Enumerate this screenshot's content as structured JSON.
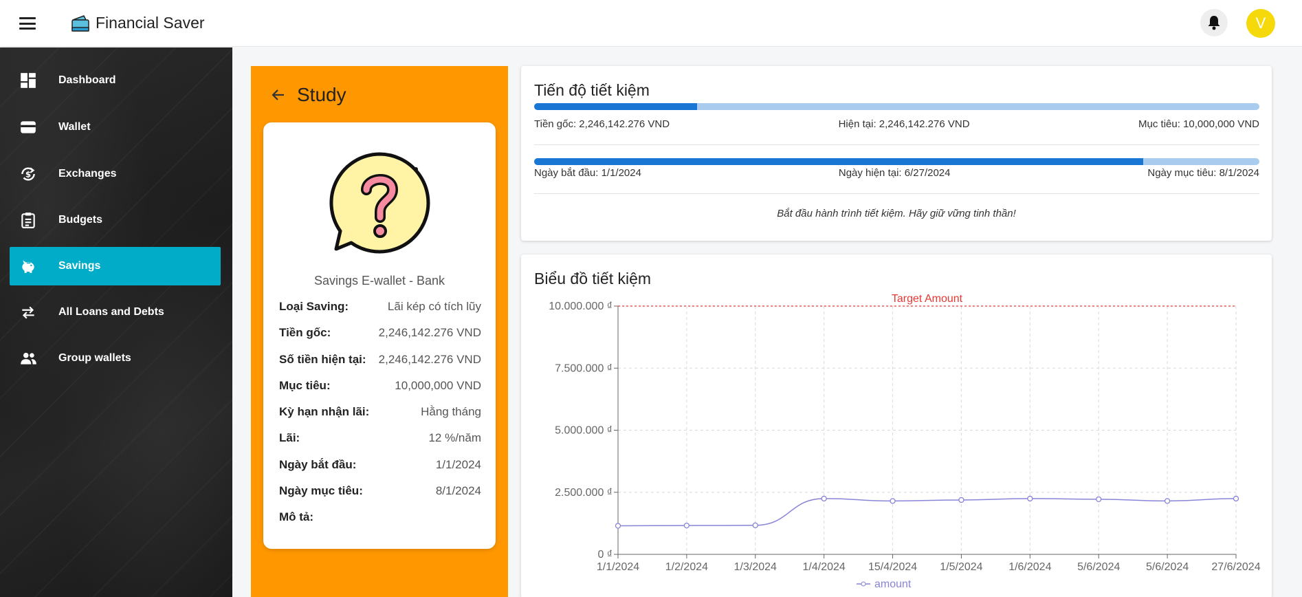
{
  "header": {
    "app_title": "Financial Saver",
    "avatar_letter": "V",
    "menu_icon": "menu-icon",
    "bell_icon": "bell-icon",
    "logo_icon": "wallet-logo-icon"
  },
  "sidebar": {
    "items": [
      {
        "label": "Dashboard",
        "icon": "dashboard-icon",
        "active": false
      },
      {
        "label": "Wallet",
        "icon": "wallet-icon",
        "active": false
      },
      {
        "label": "Exchanges",
        "icon": "exchange-icon",
        "active": false
      },
      {
        "label": "Budgets",
        "icon": "clipboard-icon",
        "active": false
      },
      {
        "label": "Savings",
        "icon": "piggy-bank-icon",
        "active": true
      },
      {
        "label": "All Loans and Debts",
        "icon": "transfer-arrows-icon",
        "active": false
      },
      {
        "label": "Group wallets",
        "icon": "group-icon",
        "active": false
      }
    ],
    "active_color": "#00acc8"
  },
  "saving": {
    "title": "Study",
    "subtitle": "Savings E-wallet - Bank",
    "icon": "question-bubble-icon",
    "details": [
      {
        "label": "Loại Saving:",
        "value": "Lãi kép có tích lũy"
      },
      {
        "label": "Tiền gốc:",
        "value": "2,246,142.276 VND"
      },
      {
        "label": "Số tiền hiện tại:",
        "value": "2,246,142.276 VND"
      },
      {
        "label": "Mục tiêu:",
        "value": "10,000,000 VND"
      },
      {
        "label": "Kỳ hạn nhận lãi:",
        "value": "Hằng tháng"
      },
      {
        "label": "Lãi:",
        "value": "12 %/năm"
      },
      {
        "label": "Ngày bắt đầu:",
        "value": "1/1/2024"
      },
      {
        "label": "Ngày mục tiêu:",
        "value": "8/1/2024"
      },
      {
        "label": "Mô tả:",
        "value": ""
      }
    ],
    "panel_color": "#ff9700"
  },
  "progress": {
    "title": "Tiến độ tiết kiệm",
    "amount_fraction": 0.2246,
    "amount_labels": {
      "principal": "Tiền gốc: 2,246,142.276 VND",
      "current": "Hiện tại: 2,246,142.276 VND",
      "target": "Mục tiêu: 10,000,000 VND"
    },
    "time_fraction": 0.84,
    "time_labels": {
      "start": "Ngày bắt đầu: 1/1/2024",
      "current": "Ngày hiện tại: 6/27/2024",
      "target": "Ngày mục tiêu: 8/1/2024"
    },
    "motto": "Bắt đầu hành trình tiết kiệm. Hãy giữ vững tinh thần!",
    "bar_color": "#1976d2",
    "track_color": "#a9cbee"
  },
  "chart_data": {
    "type": "line",
    "title": "Biểu đồ tiết kiệm",
    "categories": [
      "1/1/2024",
      "1/2/2024",
      "1/3/2024",
      "1/4/2024",
      "15/4/2024",
      "1/5/2024",
      "1/6/2024",
      "5/6/2024",
      "5/6/2024",
      "27/6/2024"
    ],
    "series": [
      {
        "name": "amount",
        "values": [
          1150000,
          1160000,
          1170000,
          2246142,
          2150000,
          2190000,
          2246142,
          2220000,
          2150000,
          2246142
        ],
        "color": "#8884d8"
      }
    ],
    "ylim": [
      0,
      10000000
    ],
    "yticks": [
      0,
      2500000,
      5000000,
      7500000,
      10000000
    ],
    "ytick_labels": [
      "0 ₫",
      "2.500.000 ₫",
      "5.000.000 ₫",
      "7.500.000 ₫",
      "10.000.000 ₫"
    ],
    "reference_line": {
      "label": "Target Amount",
      "value": 10000000,
      "color": "#e53935"
    },
    "grid": true,
    "legend": "bottom"
  }
}
